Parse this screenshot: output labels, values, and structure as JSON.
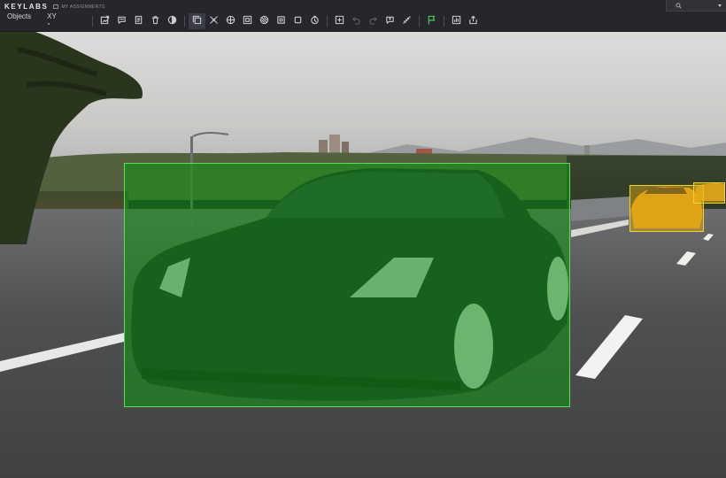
{
  "app": {
    "logo_text": "KEYLABS",
    "assignments_label": "MY ASSIGNMENTS"
  },
  "panel_tabs": [
    {
      "label": "Objects"
    },
    {
      "label": "XY"
    }
  ],
  "toolbar": {
    "items": [
      {
        "icon": "attach-image-icon"
      },
      {
        "icon": "comment-icon"
      },
      {
        "icon": "document-icon"
      },
      {
        "icon": "trash-icon"
      },
      {
        "icon": "contrast-icon"
      },
      {
        "icon": "bounding-box-icon",
        "selected": true
      },
      {
        "icon": "keypoints-icon"
      },
      {
        "icon": "polygon-icon"
      },
      {
        "icon": "segmentation-icon"
      },
      {
        "icon": "mask-icon"
      },
      {
        "icon": "cuboid-icon"
      },
      {
        "icon": "square-icon"
      },
      {
        "icon": "timer-icon"
      },
      {
        "icon": "add-box-icon"
      },
      {
        "icon": "undo-icon",
        "disabled": true
      },
      {
        "icon": "redo-icon",
        "disabled": true
      },
      {
        "icon": "ai-assist-icon"
      },
      {
        "icon": "ruler-icon"
      },
      {
        "icon": "flag-icon",
        "accent": "#57d14f"
      },
      {
        "icon": "statistics-icon"
      },
      {
        "icon": "export-icon"
      }
    ]
  },
  "annotations": [
    {
      "label_class": "car",
      "color": "#2ea82e",
      "selected": true
    },
    {
      "label_class": "car",
      "color": "#e8b21a"
    },
    {
      "label_class": "car",
      "color": "#e8b21a"
    }
  ],
  "colors": {
    "topbar": "#25272c",
    "selected_box": "#55e055",
    "secondary_box": "#f2d22a"
  }
}
